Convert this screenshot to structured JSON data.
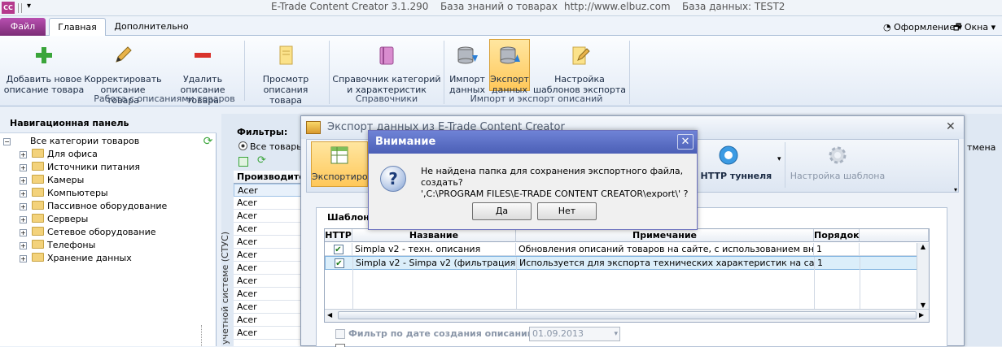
{
  "window": {
    "title": "E-Trade Content Creator 3.1.290",
    "kb": "База знаний о товарах",
    "url": "http://www.elbuz.com",
    "db": "База данных: TEST2"
  },
  "ribbon": {
    "tabs": [
      "Файл",
      "Главная",
      "Дополнительно"
    ],
    "right": {
      "style": "Оформление",
      "windows": "Окна"
    },
    "groups": [
      {
        "label": "Работа с описаниями товаров",
        "buttons": [
          {
            "line1": "Добавить новое",
            "line2": "описание товара",
            "icon": "plus-icon"
          },
          {
            "line1": "Корректировать",
            "line2": "описание товара",
            "icon": "pencil-icon"
          },
          {
            "line1": "Удалить",
            "line2": "описание товара",
            "icon": "minus-icon"
          },
          {
            "line1": "Просмотр",
            "line2": "описания товара",
            "icon": "document-icon"
          }
        ]
      },
      {
        "label": "Справочники",
        "buttons": [
          {
            "line1": "Справочник категорий",
            "line2": "и характеристик",
            "icon": "book-icon"
          }
        ]
      },
      {
        "label": "Импорт и экспорт описаний",
        "buttons": [
          {
            "line1": "Импорт",
            "line2": "данных",
            "icon": "db-import-icon"
          },
          {
            "line1": "Экспорт",
            "line2": "данных",
            "icon": "db-export-icon"
          },
          {
            "line1": "Настройка",
            "line2": "шаблонов экспорта",
            "icon": "template-icon"
          }
        ]
      }
    ]
  },
  "nav": {
    "title": "Навигационная панель",
    "root": "Все категории товаров",
    "items": [
      "Для офиса",
      "Источники питания",
      "Камеры",
      "Компьютеры",
      "Пассивное оборудование",
      "Серверы",
      "Сетевое оборудование",
      "Телефоны",
      "Хранение данных"
    ]
  },
  "filters": {
    "label": "Фильтры:",
    "all_products": "Все товары",
    "manufacturer_header": "Производите",
    "manufacturers": [
      "Acer",
      "Acer",
      "Acer",
      "Acer",
      "Acer",
      "Acer",
      "Acer",
      "Acer",
      "Acer",
      "Acer",
      "Acer",
      "Acer"
    ],
    "vertical_text": "учетной системе (СТУС)",
    "right_clip": "тмена"
  },
  "export_dialog": {
    "title": "Экспорт данных из E-Trade Content Creator",
    "toolbar": {
      "export": "Экспортиро",
      "http_tunnel": "ка HTTP туннеля",
      "template_settings": "Настройка шаблона"
    },
    "templates_label": "Шаблоны",
    "columns": [
      "HTTP",
      "Название",
      "Примечание",
      "Порядок"
    ],
    "rows": [
      {
        "checked": true,
        "name": "Simpla v2 - техн. описания",
        "note": "Обновления описаний товаров на сайте, с использованием внешнего п",
        "order": "1"
      },
      {
        "checked": true,
        "name": "Simpla v2 - Simpa v2 (фильтрация)",
        "note": "Используется для экспорта технических характеристик на сайт для ос",
        "order": "1"
      }
    ],
    "date_filter_label": "Фильтр по дате создания описаний",
    "date_value": "01.09.2013"
  },
  "alert": {
    "title": "Внимание",
    "message_line1": "Не найдена папка для сохранения экспортного файла, создать?",
    "message_line2": "',C:\\PROGRAM FILES\\E-TRADE CONTENT CREATOR\\export\\' ?",
    "yes": "Да",
    "no": "Нет"
  }
}
